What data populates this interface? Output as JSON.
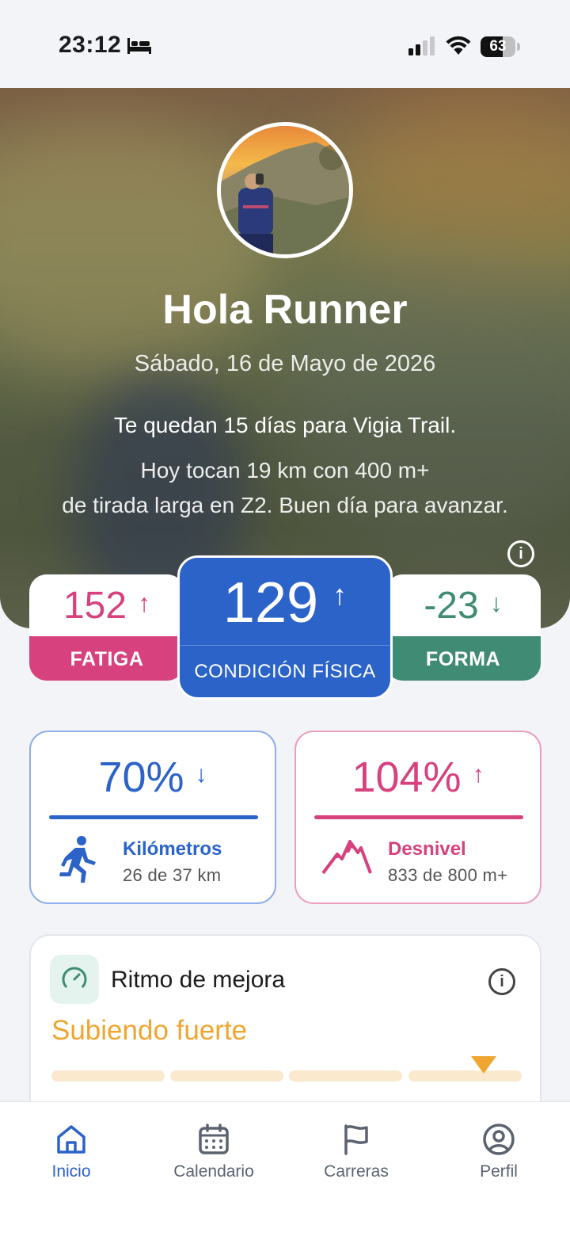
{
  "status_bar": {
    "time": "23:12",
    "battery_percent": "63",
    "battery_level": 0.63
  },
  "hero": {
    "greeting": "Hola Runner",
    "date": "Sábado, 16 de Mayo de 2026",
    "race_countdown": "Te quedan 15 días para Vigia Trail.",
    "plan_line1": "Hoy tocan 19 km con 400 m+",
    "plan_line2": "de tirada larga en Z2. Buen día para avanzar.",
    "info_icon": "info-icon"
  },
  "metrics": {
    "fatiga": {
      "value": "152",
      "label": "FATIGA",
      "trend": "↑",
      "color": "#d6417e"
    },
    "condicion": {
      "value": "129",
      "label": "CONDICIÓN FÍSICA",
      "trend": "↑",
      "color": "#2b63c8"
    },
    "forma": {
      "value": "-23",
      "label": "FORMA",
      "trend": "↓",
      "color": "#3f8b74"
    }
  },
  "goals": {
    "kilometros": {
      "percent": "70%",
      "trend": "↓",
      "title": "Kilómetros",
      "detail": "26 de 37 km",
      "icon": "runner-icon",
      "color": "#2b63c8"
    },
    "desnivel": {
      "percent": "104%",
      "trend": "↑",
      "title": "Desnivel",
      "detail": "833 de 800 m+",
      "icon": "mountain-icon",
      "color": "#d6417e"
    }
  },
  "improvement": {
    "title": "Ritmo de mejora",
    "status": "Subiendo fuerte",
    "icon": "gauge-icon",
    "level_segment": 4,
    "segments": 4,
    "accent_color": "#f0a531"
  },
  "tabbar": {
    "tabs": [
      {
        "label": "Inicio",
        "icon": "home-icon",
        "active": true
      },
      {
        "label": "Calendario",
        "icon": "calendar-icon",
        "active": false
      },
      {
        "label": "Carreras",
        "icon": "flag-icon",
        "active": false
      },
      {
        "label": "Perfil",
        "icon": "profile-icon",
        "active": false
      }
    ]
  }
}
